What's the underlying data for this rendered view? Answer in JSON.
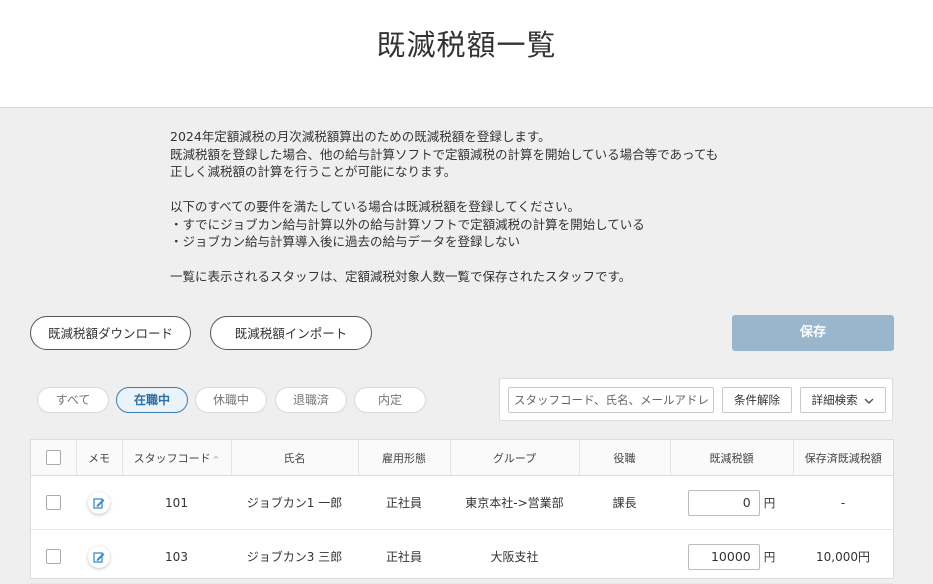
{
  "header": {
    "title": "既滅税額一覧"
  },
  "description": {
    "lines": [
      "2024年定額減税の月次減税額算出のための既減税額を登録します。",
      "既減税額を登録した場合、他の給与計算ソフトで定額減税の計算を開始している場合等であっても",
      "正しく減税額の計算を行うことが可能になります。",
      "",
      "以下のすべての要件を満たしている場合は既減税額を登録してください。",
      "・すでにジョブカン給与計算以外の給与計算ソフトで定額減税の計算を開始している",
      "・ジョブカン給与計算導入後に過去の給与データを登録しない",
      "",
      "一覧に表示されるスタッフは、定額減税対象人数一覧で保存されたスタッフです。"
    ]
  },
  "actions": {
    "download_label": "既減税額ダウンロード",
    "import_label": "既減税額インポート",
    "save_label": "保存"
  },
  "tabs": [
    {
      "label": "すべて",
      "active": false
    },
    {
      "label": "在職中",
      "active": true
    },
    {
      "label": "休職中",
      "active": false
    },
    {
      "label": "退職済",
      "active": false
    },
    {
      "label": "内定",
      "active": false
    }
  ],
  "search": {
    "placeholder": "スタッフコード、氏名、メールアドレス",
    "clear_label": "条件解除",
    "advanced_label": "詳細検索"
  },
  "table": {
    "headers": {
      "memo": "メモ",
      "code": "スタッフコード",
      "name": "氏名",
      "employment": "雇用形態",
      "group": "グループ",
      "position": "役職",
      "reduced_amount": "既減税額",
      "saved_amount": "保存済既減税額"
    },
    "currency_unit": "円",
    "rows": [
      {
        "code": "101",
        "name": "ジョブカン1 一郎",
        "employment": "正社員",
        "group": "東京本社->営業部",
        "position": "課長",
        "amount": "0",
        "saved": "-"
      },
      {
        "code": "103",
        "name": "ジョブカン3 三郎",
        "employment": "正社員",
        "group": "大阪支社",
        "position": "",
        "amount": "10000",
        "saved": "10,000円"
      }
    ]
  },
  "colors": {
    "accent": "#2e6ea6",
    "save_disabled": "#9ab6cc",
    "memo_icon": "#3a8fd0"
  }
}
